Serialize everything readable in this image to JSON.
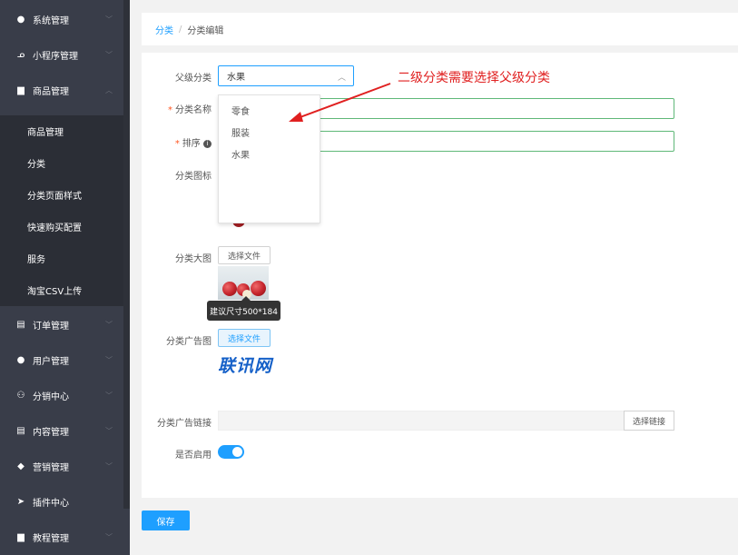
{
  "sidebar": {
    "items": [
      {
        "label": "系统管理",
        "icon": "gear-icon",
        "glyph": "●"
      },
      {
        "label": "小程序管理",
        "icon": "mini-program-icon",
        "glyph": "ᓄ"
      },
      {
        "label": "商品管理",
        "icon": "goods-icon",
        "glyph": "▆"
      },
      {
        "label": "订单管理",
        "icon": "order-icon",
        "glyph": "▤"
      },
      {
        "label": "用户管理",
        "icon": "user-icon",
        "glyph": "●"
      },
      {
        "label": "分销中心",
        "icon": "distribution-icon",
        "glyph": "⚇"
      },
      {
        "label": "内容管理",
        "icon": "content-icon",
        "glyph": "▤"
      },
      {
        "label": "营销管理",
        "icon": "marketing-icon",
        "glyph": "◆"
      },
      {
        "label": "插件中心",
        "icon": "plugin-icon",
        "glyph": "➤"
      },
      {
        "label": "教程管理",
        "icon": "tutorial-icon",
        "glyph": "▆"
      }
    ],
    "sub_items": [
      {
        "label": "商品管理"
      },
      {
        "label": "分类"
      },
      {
        "label": "分类页面样式"
      },
      {
        "label": "快速购买配置"
      },
      {
        "label": "服务"
      },
      {
        "label": "淘宝CSV上传"
      }
    ]
  },
  "breadcrumb": {
    "parent": "分类",
    "separator": "/",
    "current": "分类编辑"
  },
  "form": {
    "parent_label": "父级分类",
    "parent_value": "水果",
    "parent_options": [
      "零食",
      "服装",
      "水果"
    ],
    "name_label": "分类名称",
    "sort_label": "排序",
    "icon_label": "分类图标",
    "big_image_label": "分类大图",
    "choose_file": "选择文件",
    "ad_image_label": "分类广告图",
    "tooltip": "建议尺寸500*184",
    "ad_logo": "联讯网",
    "ad_link_label": "分类广告链接",
    "choose_link": "选择链接",
    "enabled_label": "是否启用",
    "enabled": true
  },
  "save_label": "保存",
  "annotation": "二级分类需要选择父级分类",
  "colors": {
    "sidebar_bg": "#393d49",
    "accent": "#1e9fff",
    "success": "#5fb878",
    "annotation": "#e02020"
  }
}
